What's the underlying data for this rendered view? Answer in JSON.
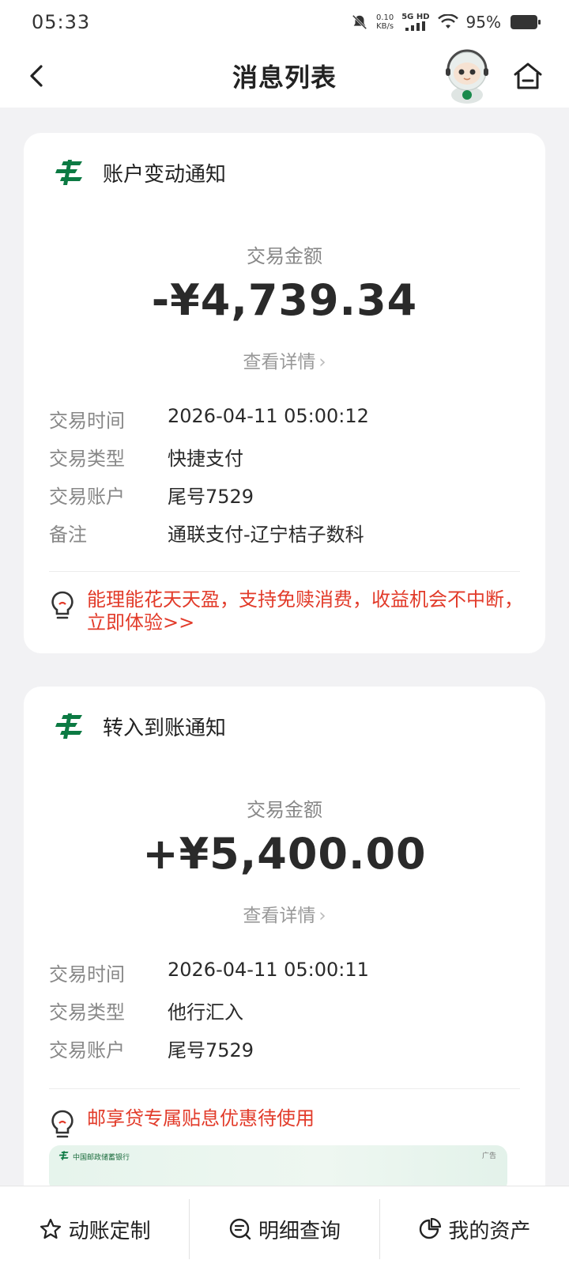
{
  "status_bar": {
    "time": "05:33",
    "net_speed_value": "0.10",
    "net_speed_unit": "KB/s",
    "signal_label": "5G HD",
    "battery": "95%"
  },
  "header": {
    "title": "消息列表"
  },
  "cards": [
    {
      "title": "账户变动通知",
      "amount_label": "交易金额",
      "amount": "-¥4,739.34",
      "detail_link": "查看详情",
      "rows": [
        {
          "key": "交易时间",
          "value": "2026-04-11 05:00:12"
        },
        {
          "key": "交易类型",
          "value": "快捷支付"
        },
        {
          "key": "交易账户",
          "value": "尾号7529"
        },
        {
          "key": "备注",
          "value": "通联支付-辽宁桔子数科"
        }
      ],
      "promo": "能理能花天天盈，支持免赎消费，收益机会不中断，立即体验>>"
    },
    {
      "title": "转入到账通知",
      "amount_label": "交易金额",
      "amount": "+¥5,400.00",
      "detail_link": "查看详情",
      "rows": [
        {
          "key": "交易时间",
          "value": "2026-04-11 05:00:11"
        },
        {
          "key": "交易类型",
          "value": "他行汇入"
        },
        {
          "key": "交易账户",
          "value": "尾号7529"
        }
      ],
      "promo": "邮享贷专属贴息优惠待使用",
      "banner_bank": "中国邮政储蓄银行",
      "banner_ad": "广告"
    }
  ],
  "bottom_tabs": [
    {
      "label": "动账定制",
      "icon": "star-icon"
    },
    {
      "label": "明细查询",
      "icon": "search-list-icon"
    },
    {
      "label": "我的资产",
      "icon": "pie-chart-icon"
    }
  ],
  "colors": {
    "brand_green": "#0c7a43",
    "promo_red": "#e23b2a",
    "background": "#f2f2f4"
  }
}
